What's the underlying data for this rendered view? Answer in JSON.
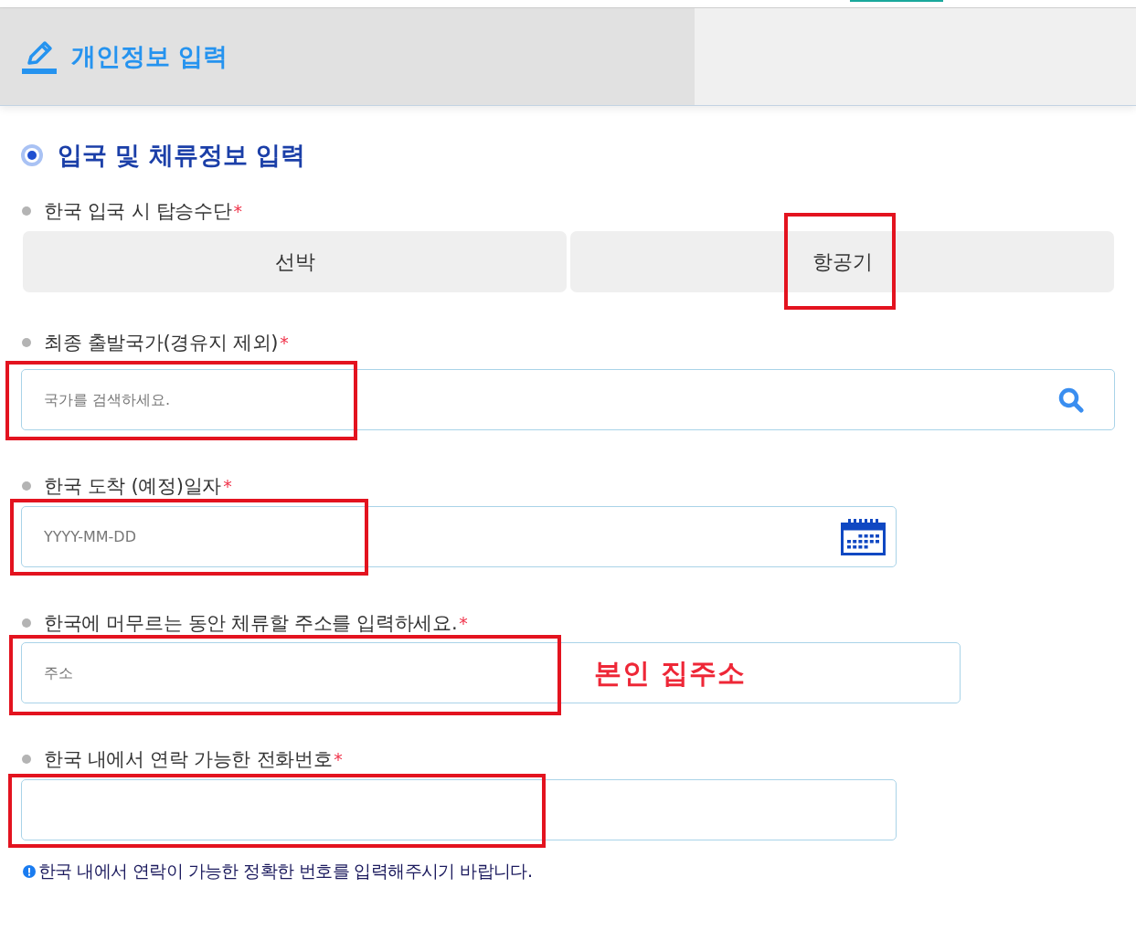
{
  "header": {
    "title": "개인정보 입력"
  },
  "section": {
    "title": "입국 및 체류정보 입력"
  },
  "fields": [
    {
      "kind": "choice",
      "label": "한국 입국 시 탑승수단",
      "required_mark": "*",
      "options": [
        {
          "label": "선박",
          "selected": false,
          "highlighted": false
        },
        {
          "label": "항공기",
          "selected": false,
          "highlighted": true
        }
      ]
    },
    {
      "kind": "search",
      "label": "최종 출발국가(경유지 제외)",
      "required_mark": "*",
      "placeholder": "국가를 검색하세요.",
      "highlighted": true
    },
    {
      "kind": "date",
      "label": "한국 도착 (예정)일자",
      "required_mark": "*",
      "placeholder": "YYYY-MM-DD",
      "highlighted": true
    },
    {
      "kind": "address",
      "label": "한국에 머무르는 동안 체류할 주소를 입력하세요.",
      "required_mark": "*",
      "placeholder": "주소",
      "highlighted": true,
      "annotation": "본인 집주소"
    },
    {
      "kind": "phone",
      "label": "한국 내에서 연락 가능한 전화번호",
      "required_mark": "*",
      "highlighted": true,
      "note": "한국 내에서 연락이 가능한 정확한 번호를 입력해주시기 바랍니다."
    }
  ]
}
